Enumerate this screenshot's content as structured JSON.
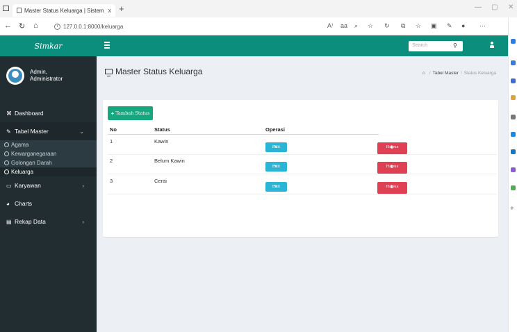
{
  "browser": {
    "tab_title": "Master Status Keluarga | Sistem I",
    "tab_close": "x",
    "new_tab": "+",
    "url": "127.0.0.1:8000/keluarga",
    "read_aloud": "A⁾",
    "aa": "aа"
  },
  "app": {
    "brand": "Simkar",
    "user_name": "Admin,",
    "user_role": "Administrator",
    "search_placeholder": "Search"
  },
  "sidebar": {
    "items": [
      {
        "label": "Dashboard"
      },
      {
        "label": "Tabel Master"
      },
      {
        "label": "Karyawan"
      },
      {
        "label": "Charts"
      },
      {
        "label": "Rekap Data"
      }
    ],
    "sub_items": [
      {
        "label": "Agama"
      },
      {
        "label": "Kewarganegaraan"
      },
      {
        "label": "Golongan Darah"
      },
      {
        "label": "Keluarga"
      }
    ]
  },
  "page": {
    "title": "Master Status Keluarga",
    "breadcrumb": [
      "Tabel Master",
      "Status Keluarga"
    ],
    "add_button": "Tambah Status",
    "columns": [
      "No",
      "Status",
      "Operasi"
    ],
    "rows": [
      {
        "no": "1",
        "status": "Kawin"
      },
      {
        "no": "2",
        "status": "Belum Kawin"
      },
      {
        "no": "3",
        "status": "Cerai"
      }
    ],
    "edit_label": "Edit",
    "delete_label": "Hapus"
  },
  "colors": {
    "brand": "#0b8f7c",
    "sidebar": "#222d32",
    "edit": "#2ab5d6",
    "delete": "#e04053",
    "add": "#17a77e"
  }
}
